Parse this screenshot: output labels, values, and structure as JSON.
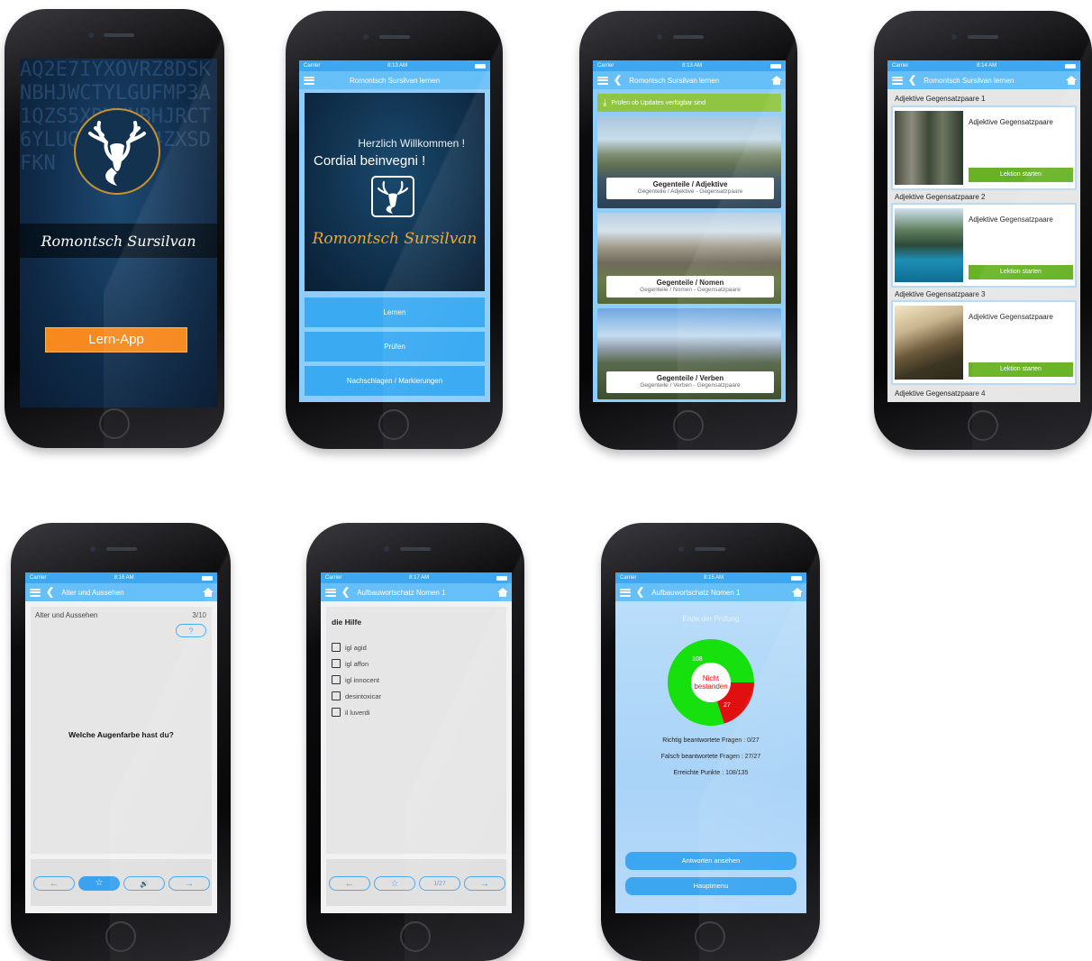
{
  "status": {
    "carrier": "Carrier",
    "t2": "8:13 AM",
    "t3": "8:13 AM",
    "t4": "8:14 AM",
    "t5": "8:16 AM",
    "t6": "8:17 AM",
    "t7": "8:15 AM"
  },
  "s1": {
    "brand": "Romontsch Sursilvan",
    "cta": "Lern-App"
  },
  "s2": {
    "nav_title": "Romontsch Sursilvan lernen",
    "welcome": "Herzlich Willkommen !",
    "cordial": "Cordial beinvegni !",
    "brand": "Romontsch Sursilvan",
    "menu": [
      "Lernen",
      "Prüfen",
      "Nachschlagen / Markierungen"
    ]
  },
  "s3": {
    "nav_title": "Romontsch Sursilvan lernen",
    "update": "Prüfen ob Updates verfügbar sind",
    "cards": [
      {
        "title": "Gegenteile / Adjektive",
        "sub": "Gegenteile / Adjektive - Gegensatzpaare"
      },
      {
        "title": "Gegenteile / Nomen",
        "sub": "Gegenteile / Nomen - Gegensatzpaare"
      },
      {
        "title": "Gegenteile / Verben",
        "sub": "Gegenteile / Verben - Gegensatzpaare"
      }
    ]
  },
  "s4": {
    "nav_title": "Romontsch Sursilvan lernen",
    "lessons": [
      {
        "head": "Adjektive Gegensatzpaare 1",
        "desc": "Adjektive Gegensatzpaare",
        "button": "Lektion starten"
      },
      {
        "head": "Adjektive Gegensatzpaare 2",
        "desc": "Adjektive Gegensatzpaare",
        "button": "Lektion starten"
      },
      {
        "head": "Adjektive Gegensatzpaare 3",
        "desc": "Adjektive Gegensatzpaare",
        "button": "Lektion starten"
      }
    ],
    "next_head": "Adjektive Gegensatzpaare 4"
  },
  "s5": {
    "nav_title": "Alter und Aussehen",
    "topic": "Alter und Aussehen",
    "counter": "3/10",
    "hint": "?",
    "question": "Welche Augenfarbe hast du?",
    "prev": "←",
    "fav": "☆",
    "audio": "🔊",
    "next": "→"
  },
  "s6": {
    "nav_title": "Aufbauwortschatz Nomen 1",
    "question": "die Hilfe",
    "options": [
      "igl agid",
      "igl affon",
      "igl innocent",
      "desintoxicar",
      "il luverdi"
    ],
    "prev": "←",
    "fav": "☆",
    "page": "1/27",
    "next": "→"
  },
  "s7": {
    "nav_title": "Aufbauwortschatz Nomen 1",
    "heading": "Ende der Prüfung",
    "donut": {
      "correct": 108,
      "wrong": 27,
      "center": "Nicht bestanden",
      "label_correct": "108",
      "label_wrong": "27",
      "color_correct": "#16e00e",
      "color_wrong": "#e01010"
    },
    "stats": [
      "Richtig beantwortete Fragen : 0/27",
      "Falsch beantwortete Fragen : 27/27",
      "Erreichte Punkte : 108/135"
    ],
    "btn_answers": "Antworten ansehen",
    "btn_menu": "Hauptmenu"
  }
}
